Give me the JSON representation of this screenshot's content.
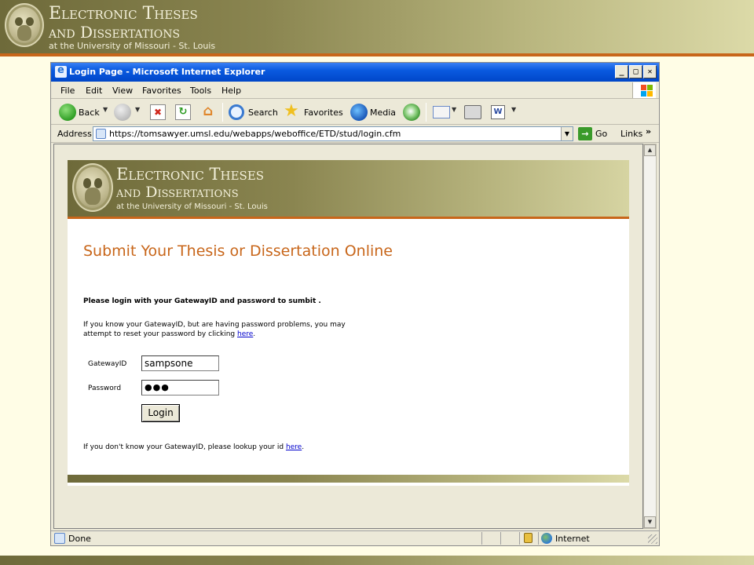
{
  "slide": {
    "title_line1": "Electronic Theses",
    "title_line2": "and Dissertations",
    "subtitle": "at the University of Missouri - St. Louis"
  },
  "browser": {
    "window_title": "Login Page - Microsoft Internet Explorer",
    "window_buttons": {
      "minimize": "_",
      "maximize": "□",
      "close": "✕"
    },
    "menu": [
      "File",
      "Edit",
      "View",
      "Favorites",
      "Tools",
      "Help"
    ],
    "toolbar": {
      "back": "Back",
      "search": "Search",
      "favorites": "Favorites",
      "media": "Media"
    },
    "address": {
      "label": "Address",
      "url": "https://tomsawyer.umsl.edu/webapps/weboffice/ETD/stud/login.cfm",
      "go": "Go",
      "links": "Links",
      "links_chevron": "»"
    },
    "status": {
      "text": "Done",
      "zone": "Internet"
    }
  },
  "page": {
    "header_title_line1": "Electronic Theses",
    "header_title_line2": "and Dissertations",
    "header_subtitle": "at the University of Missouri - St. Louis",
    "heading": "Submit Your Thesis or Dissertation Online",
    "instruction": "Please login with your GatewayID and password to sumbit .",
    "password_help_line1": "If you know your GatewayID, but are having password problems, you may",
    "password_help_line2_prefix": "attempt to reset your password by clicking ",
    "password_help_link": "here",
    "password_help_suffix": ".",
    "gateway_label": "GatewayID",
    "gateway_value": "sampsone",
    "password_label": "Password",
    "password_mask": "●●●",
    "login_button": "Login",
    "lookup_prefix": "If you don't know your GatewayID, please lookup your id ",
    "lookup_link": "here",
    "lookup_suffix": "."
  },
  "colors": {
    "accent_orange": "#c8661a",
    "olive": "#8a8550",
    "link_blue": "#0000cc",
    "xp_title_blue": "#0046c8"
  }
}
